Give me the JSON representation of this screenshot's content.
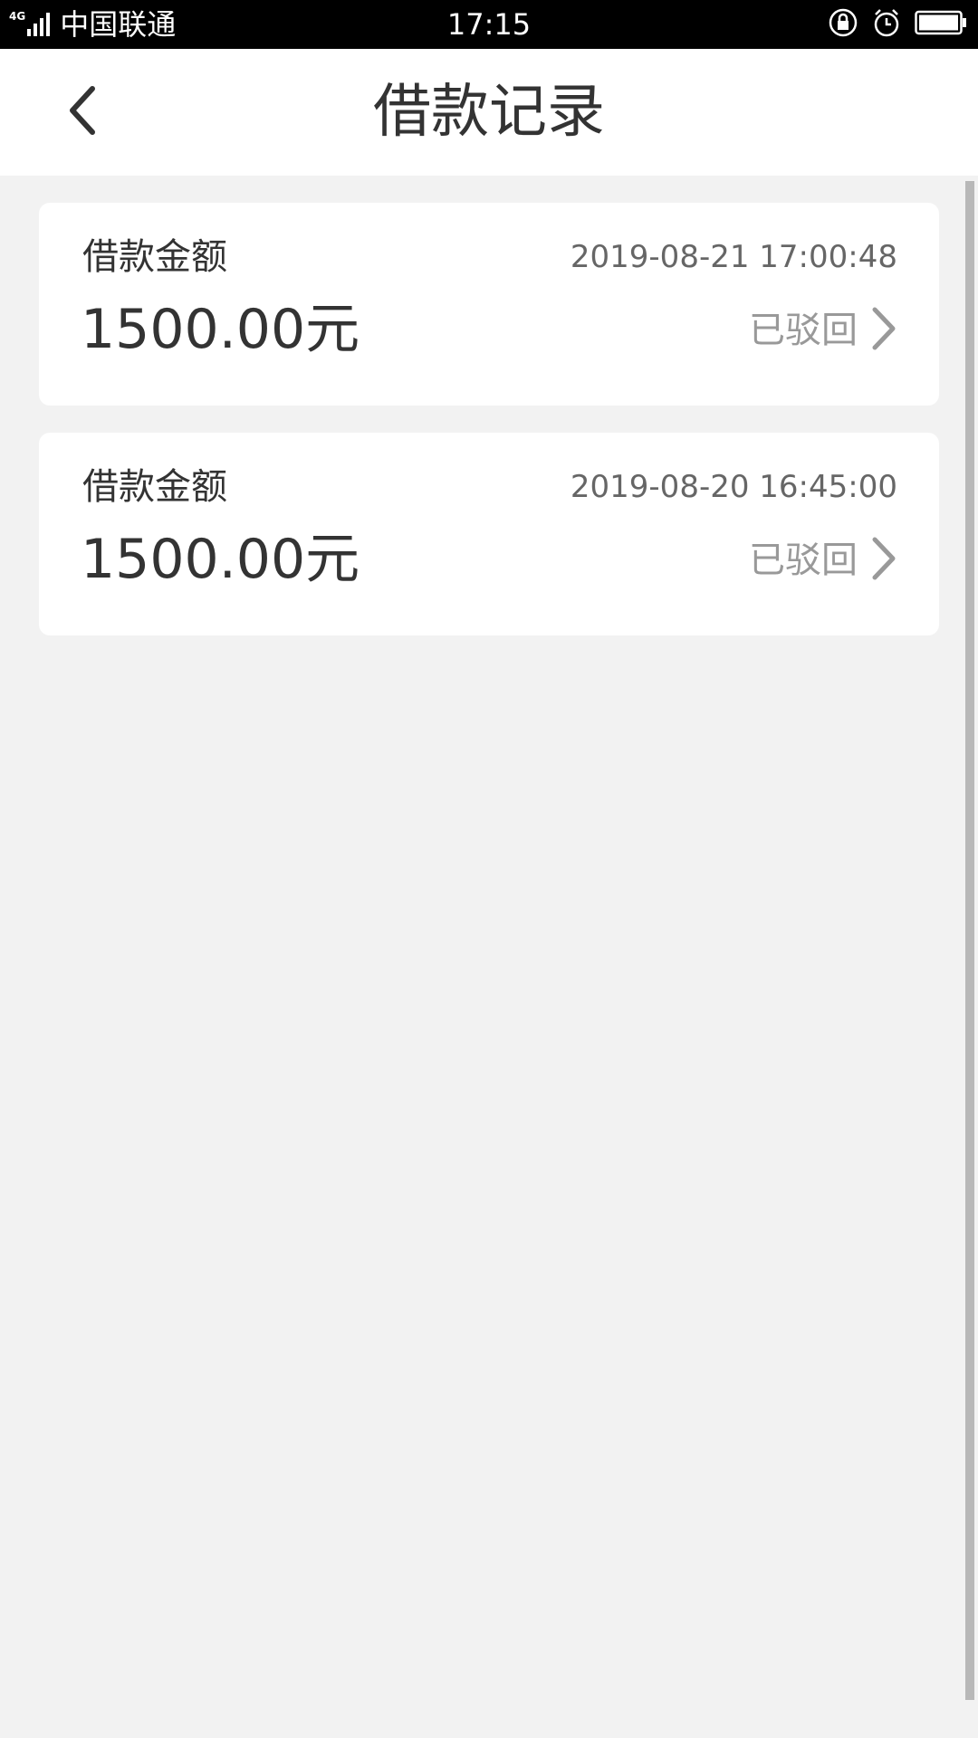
{
  "status_bar": {
    "network": "4G",
    "carrier": "中国联通",
    "time": "17:15",
    "icons": [
      "signal-icon",
      "lock-rotation-icon",
      "alarm-icon",
      "battery-icon"
    ]
  },
  "header": {
    "title": "借款记录",
    "back_icon": "chevron-left-icon"
  },
  "records": [
    {
      "label": "借款金额",
      "datetime": "2019-08-21 17:00:48",
      "amount": "1500.00元",
      "status": "已驳回"
    },
    {
      "label": "借款金额",
      "datetime": "2019-08-20 16:45:00",
      "amount": "1500.00元",
      "status": "已驳回"
    }
  ],
  "colors": {
    "background": "#f2f2f2",
    "card": "#ffffff",
    "primary_text": "#333333",
    "secondary_text": "#666666",
    "status_text": "#999999"
  }
}
